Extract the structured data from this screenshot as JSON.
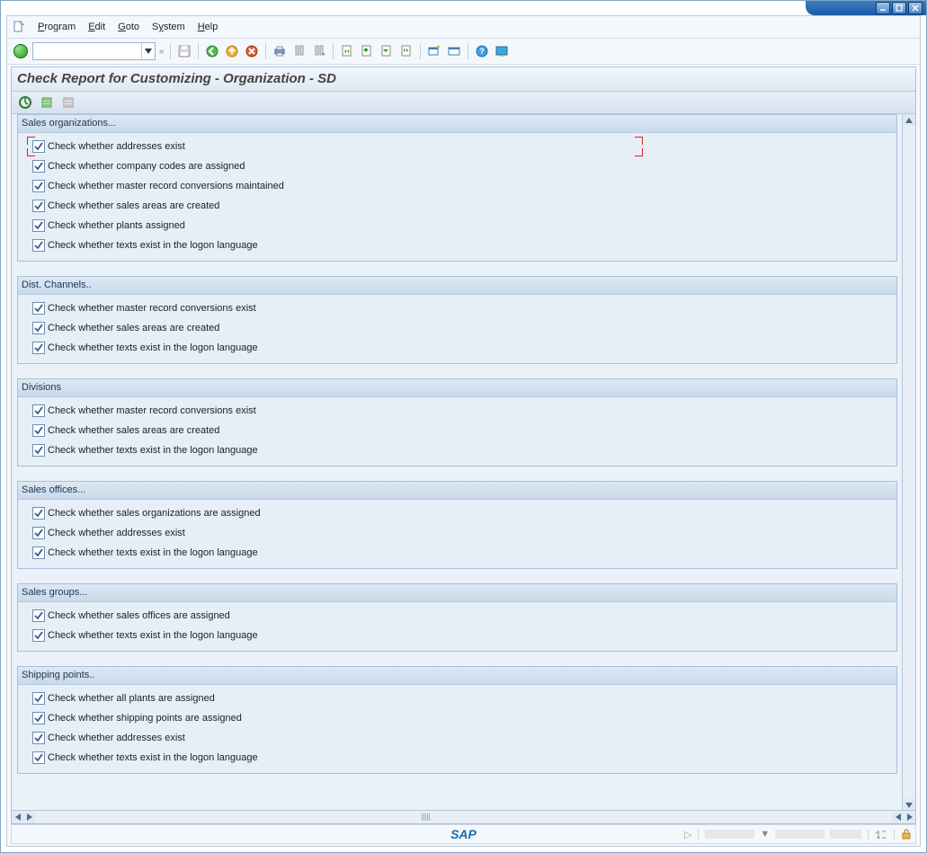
{
  "menu": {
    "program": "Program",
    "edit": "Edit",
    "goto": "Goto",
    "system": "System",
    "help": "Help"
  },
  "header": "Check Report for Customizing - Organization - SD",
  "groups": [
    {
      "title": "Sales organizations...",
      "items": [
        "Check whether addresses exist",
        "Check whether company codes are assigned",
        "Check whether master record conversions maintained",
        "Check whether sales areas are created",
        "Check whether plants assigned",
        "Check whether texts exist in the logon language"
      ]
    },
    {
      "title": "Dist. Channels..",
      "items": [
        "Check whether master record conversions exist",
        "Check whether sales areas are created",
        "Check whether texts exist in the logon language"
      ]
    },
    {
      "title": "Divisions",
      "items": [
        "Check whether master record conversions exist",
        "Check whether sales areas are created",
        "Check whether texts exist in the logon language"
      ]
    },
    {
      "title": "Sales offices...",
      "items": [
        "Check whether sales organizations are assigned",
        "Check whether addresses exist",
        "Check whether texts exist in the logon language"
      ]
    },
    {
      "title": "Sales groups...",
      "items": [
        "Check whether sales offices are assigned",
        "Check whether texts exist in the logon language"
      ]
    },
    {
      "title": "Shipping points..",
      "items": [
        "Check whether all plants are assigned",
        "Check whether shipping points are assigned",
        "Check whether addresses exist",
        "Check whether texts exist in the logon language"
      ]
    }
  ],
  "logo": "SAP"
}
